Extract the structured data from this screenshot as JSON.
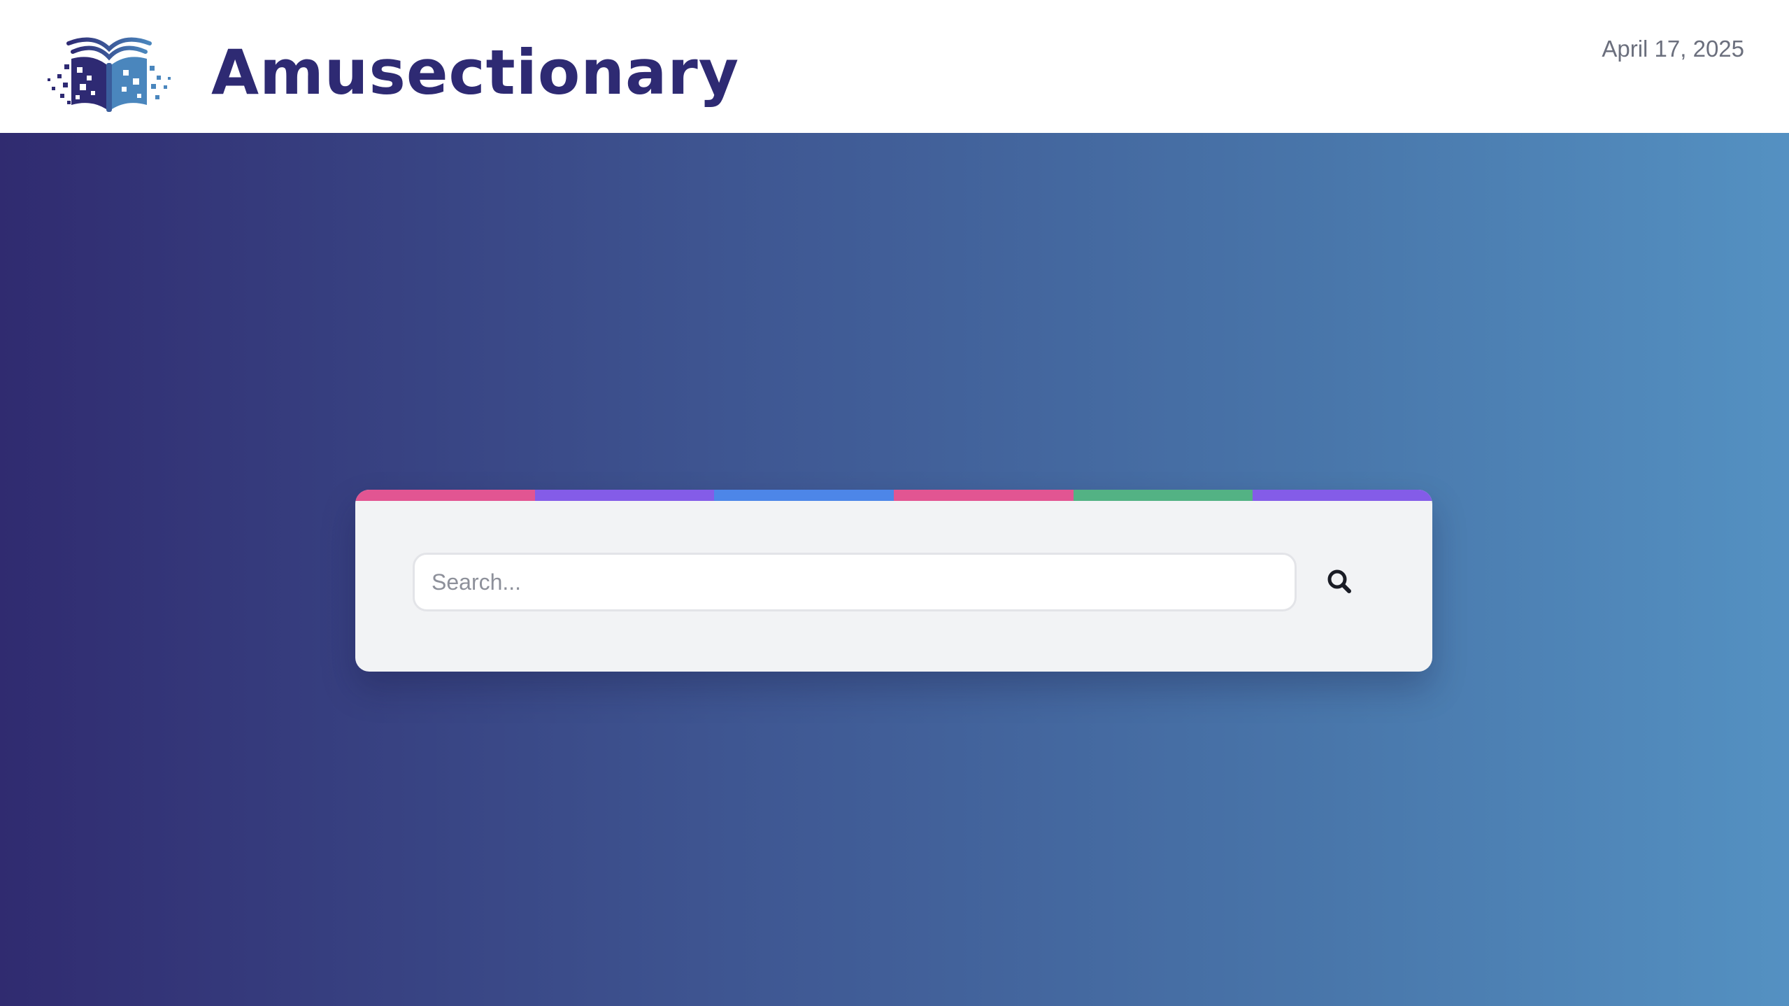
{
  "header": {
    "brand_name": "Amusectionary",
    "date": "April 17, 2025",
    "logo_icon": "open-book-pixel-icon",
    "brand_color": "#2e2a73"
  },
  "search": {
    "placeholder": "Search...",
    "value": "",
    "button_icon": "search-icon",
    "stripe_colors": [
      "#e25592",
      "#845ce8",
      "#4d86e8",
      "#e25592",
      "#53b284",
      "#845ce8"
    ]
  },
  "theme": {
    "background_gradient": [
      "#302b70",
      "#5491c2"
    ],
    "card_background": "#f2f3f5"
  }
}
